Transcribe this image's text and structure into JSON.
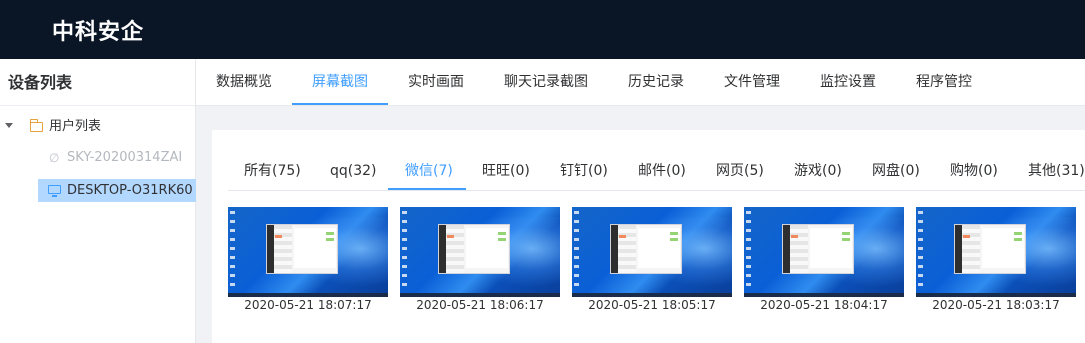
{
  "header": {
    "brand": "中科安企"
  },
  "sidebar": {
    "title": "设备列表",
    "root": {
      "label": "用户列表",
      "icon": "folder-icon"
    },
    "devices": [
      {
        "label": "SKY-20200314ZAI",
        "icon": "link-icon",
        "status": "offline"
      },
      {
        "label": "DESKTOP-O31RK60",
        "icon": "monitor-icon",
        "status": "selected"
      }
    ]
  },
  "main_tabs": [
    {
      "label": "数据概览"
    },
    {
      "label": "屏幕截图",
      "active": true
    },
    {
      "label": "实时画面"
    },
    {
      "label": "聊天记录截图"
    },
    {
      "label": "历史记录"
    },
    {
      "label": "文件管理"
    },
    {
      "label": "监控设置"
    },
    {
      "label": "程序管控"
    }
  ],
  "category_tabs": [
    {
      "label": "所有(75)"
    },
    {
      "label": "qq(32)"
    },
    {
      "label": "微信(7)",
      "active": true
    },
    {
      "label": "旺旺(0)"
    },
    {
      "label": "钉钉(0)"
    },
    {
      "label": "邮件(0)"
    },
    {
      "label": "网页(5)"
    },
    {
      "label": "游戏(0)"
    },
    {
      "label": "网盘(0)"
    },
    {
      "label": "购物(0)"
    },
    {
      "label": "其他(31)"
    }
  ],
  "screenshots": [
    {
      "timestamp": "2020-05-21 18:07:17"
    },
    {
      "timestamp": "2020-05-21 18:06:17"
    },
    {
      "timestamp": "2020-05-21 18:05:17"
    },
    {
      "timestamp": "2020-05-21 18:04:17"
    },
    {
      "timestamp": "2020-05-21 18:03:17"
    }
  ],
  "colors": {
    "accent": "#409eff",
    "header_bg": "#0a1526",
    "selected_bg": "#b3d8ff"
  }
}
